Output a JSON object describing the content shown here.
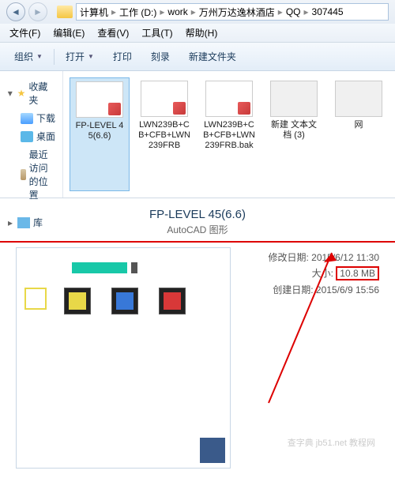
{
  "nav_back": "◄",
  "nav_fwd": "►",
  "breadcrumb": {
    "items": [
      "计算机",
      "工作 (D:)",
      "work",
      "万州万达逸林酒店",
      "QQ",
      "307445"
    ],
    "sep": "▸"
  },
  "menu": {
    "file": "文件(F)",
    "edit": "编辑(E)",
    "view": "查看(V)",
    "tools": "工具(T)",
    "help": "帮助(H)"
  },
  "toolbar": {
    "organize": "组织",
    "open": "打开",
    "print": "打印",
    "burn": "刻录",
    "newfolder": "新建文件夹",
    "arrow": "▼"
  },
  "sidebar": {
    "fav": "收藏夹",
    "downloads": "下载",
    "desktop": "桌面",
    "recent": "最近访问的位置",
    "lib": "库",
    "caret_open": "▾",
    "caret_closed": "▸"
  },
  "files": [
    {
      "name": "FP-LEVEL 45(6.6)",
      "sel": true,
      "type": "dwg"
    },
    {
      "name": "LWN239B+CB+CFB+LWN239FRB",
      "sel": false,
      "type": "dwg"
    },
    {
      "name": "LWN239B+CB+CFB+LWN239FRB.bak",
      "sel": false,
      "type": "dwg"
    },
    {
      "name": "新建 文本文档 (3)",
      "sel": false,
      "type": "txt"
    },
    {
      "name": "网",
      "sel": false,
      "type": "txt"
    }
  ],
  "preview": {
    "title": "FP-LEVEL 45(6.6)",
    "subtitle": "AutoCAD 图形",
    "meta": {
      "mod_label": "修改日期:",
      "mod_val": "2015/6/12 11:30",
      "size_label": "大小:",
      "size_val": "10.8 MB",
      "create_label": "创建日期:",
      "create_val": "2015/6/9 15:56"
    }
  },
  "watermark": "查字典 jb51.net 教程网"
}
